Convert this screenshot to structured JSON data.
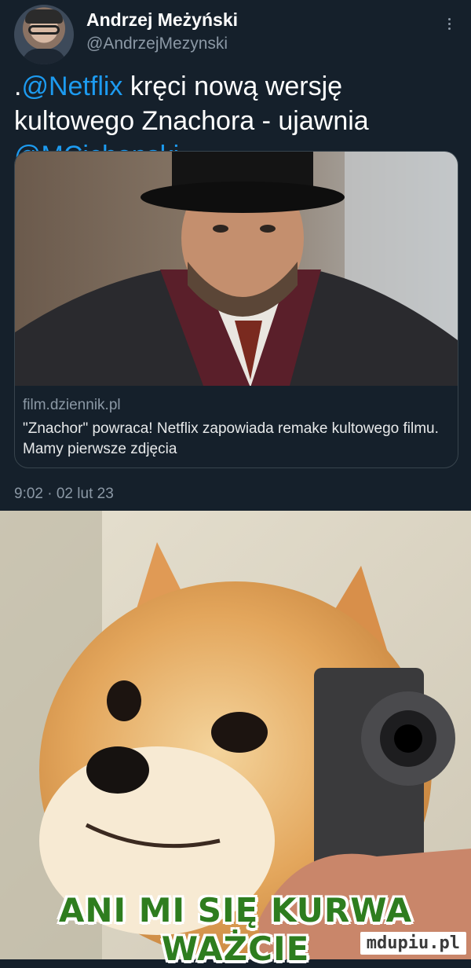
{
  "tweet": {
    "author_name": "Andrzej Meżyński",
    "author_handle": "@AndrzejMezynski",
    "text_prefix": ".",
    "mention_1": "@Netflix",
    "text_middle": " kręci nową wersję kultowego Znachora - ujawnia ",
    "mention_2": "@MCichonski",
    "card": {
      "domain": "film.dziennik.pl",
      "title": "\"Znachor\" powraca! Netflix zapowiada remake kultowego filmu. Mamy pierwsze zdjęcia"
    },
    "timestamp": "9:02 · 02 lut 23"
  },
  "meme": {
    "caption": "ANI MI SIĘ KURWA WAŻCIE",
    "watermark": "mdupiu.pl"
  },
  "colors": {
    "background": "#15202b",
    "mention": "#1d9bf0",
    "caption": "#2e7d1f"
  },
  "icons": {
    "more": "more-vertical-icon"
  }
}
